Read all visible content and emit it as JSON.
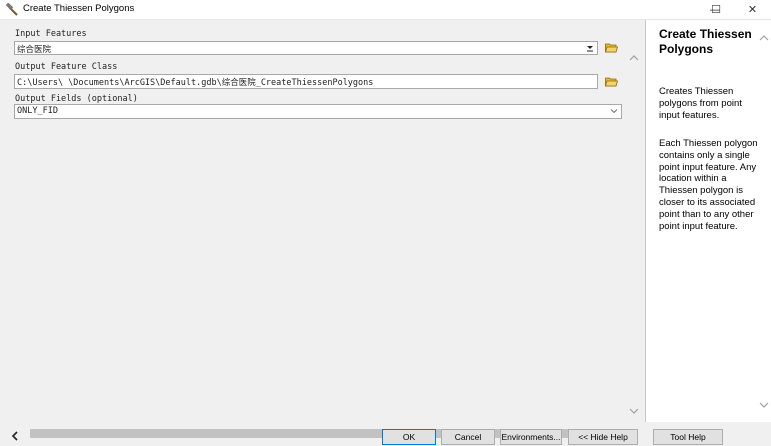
{
  "window": {
    "title": "Create Thiessen Polygons",
    "controls": {
      "minimize": "—",
      "maximize": "☐",
      "close": "✕"
    }
  },
  "form": {
    "input_features": {
      "label": "Input Features",
      "value": "综合医院"
    },
    "output_feature_class": {
      "label": "Output Feature Class",
      "value": "C:\\Users\\        \\Documents\\ArcGIS\\Default.gdb\\综合医院_CreateThiessenPolygons"
    },
    "output_fields": {
      "label": "Output Fields (optional)",
      "value": "ONLY_FID"
    }
  },
  "help": {
    "title": "Create Thiessen Polygons",
    "paragraphs": [
      "Creates Thiessen polygons from point input features.",
      "Each Thiessen polygon contains only a single point input feature. Any location within a Thiessen polygon is closer to its associated point than to any other point input feature."
    ]
  },
  "buttons": {
    "ok": "OK",
    "cancel": "Cancel",
    "environments": "Environments...",
    "hide_help": "<< Hide Help",
    "tool_help": "Tool Help"
  },
  "icons": {
    "app": "hammer-icon",
    "folder": "folder-open-icon",
    "dropdown": "chevron-down-icon"
  },
  "colors": {
    "ok_border": "#0078d7",
    "folder_yellow": "#e8b923"
  }
}
